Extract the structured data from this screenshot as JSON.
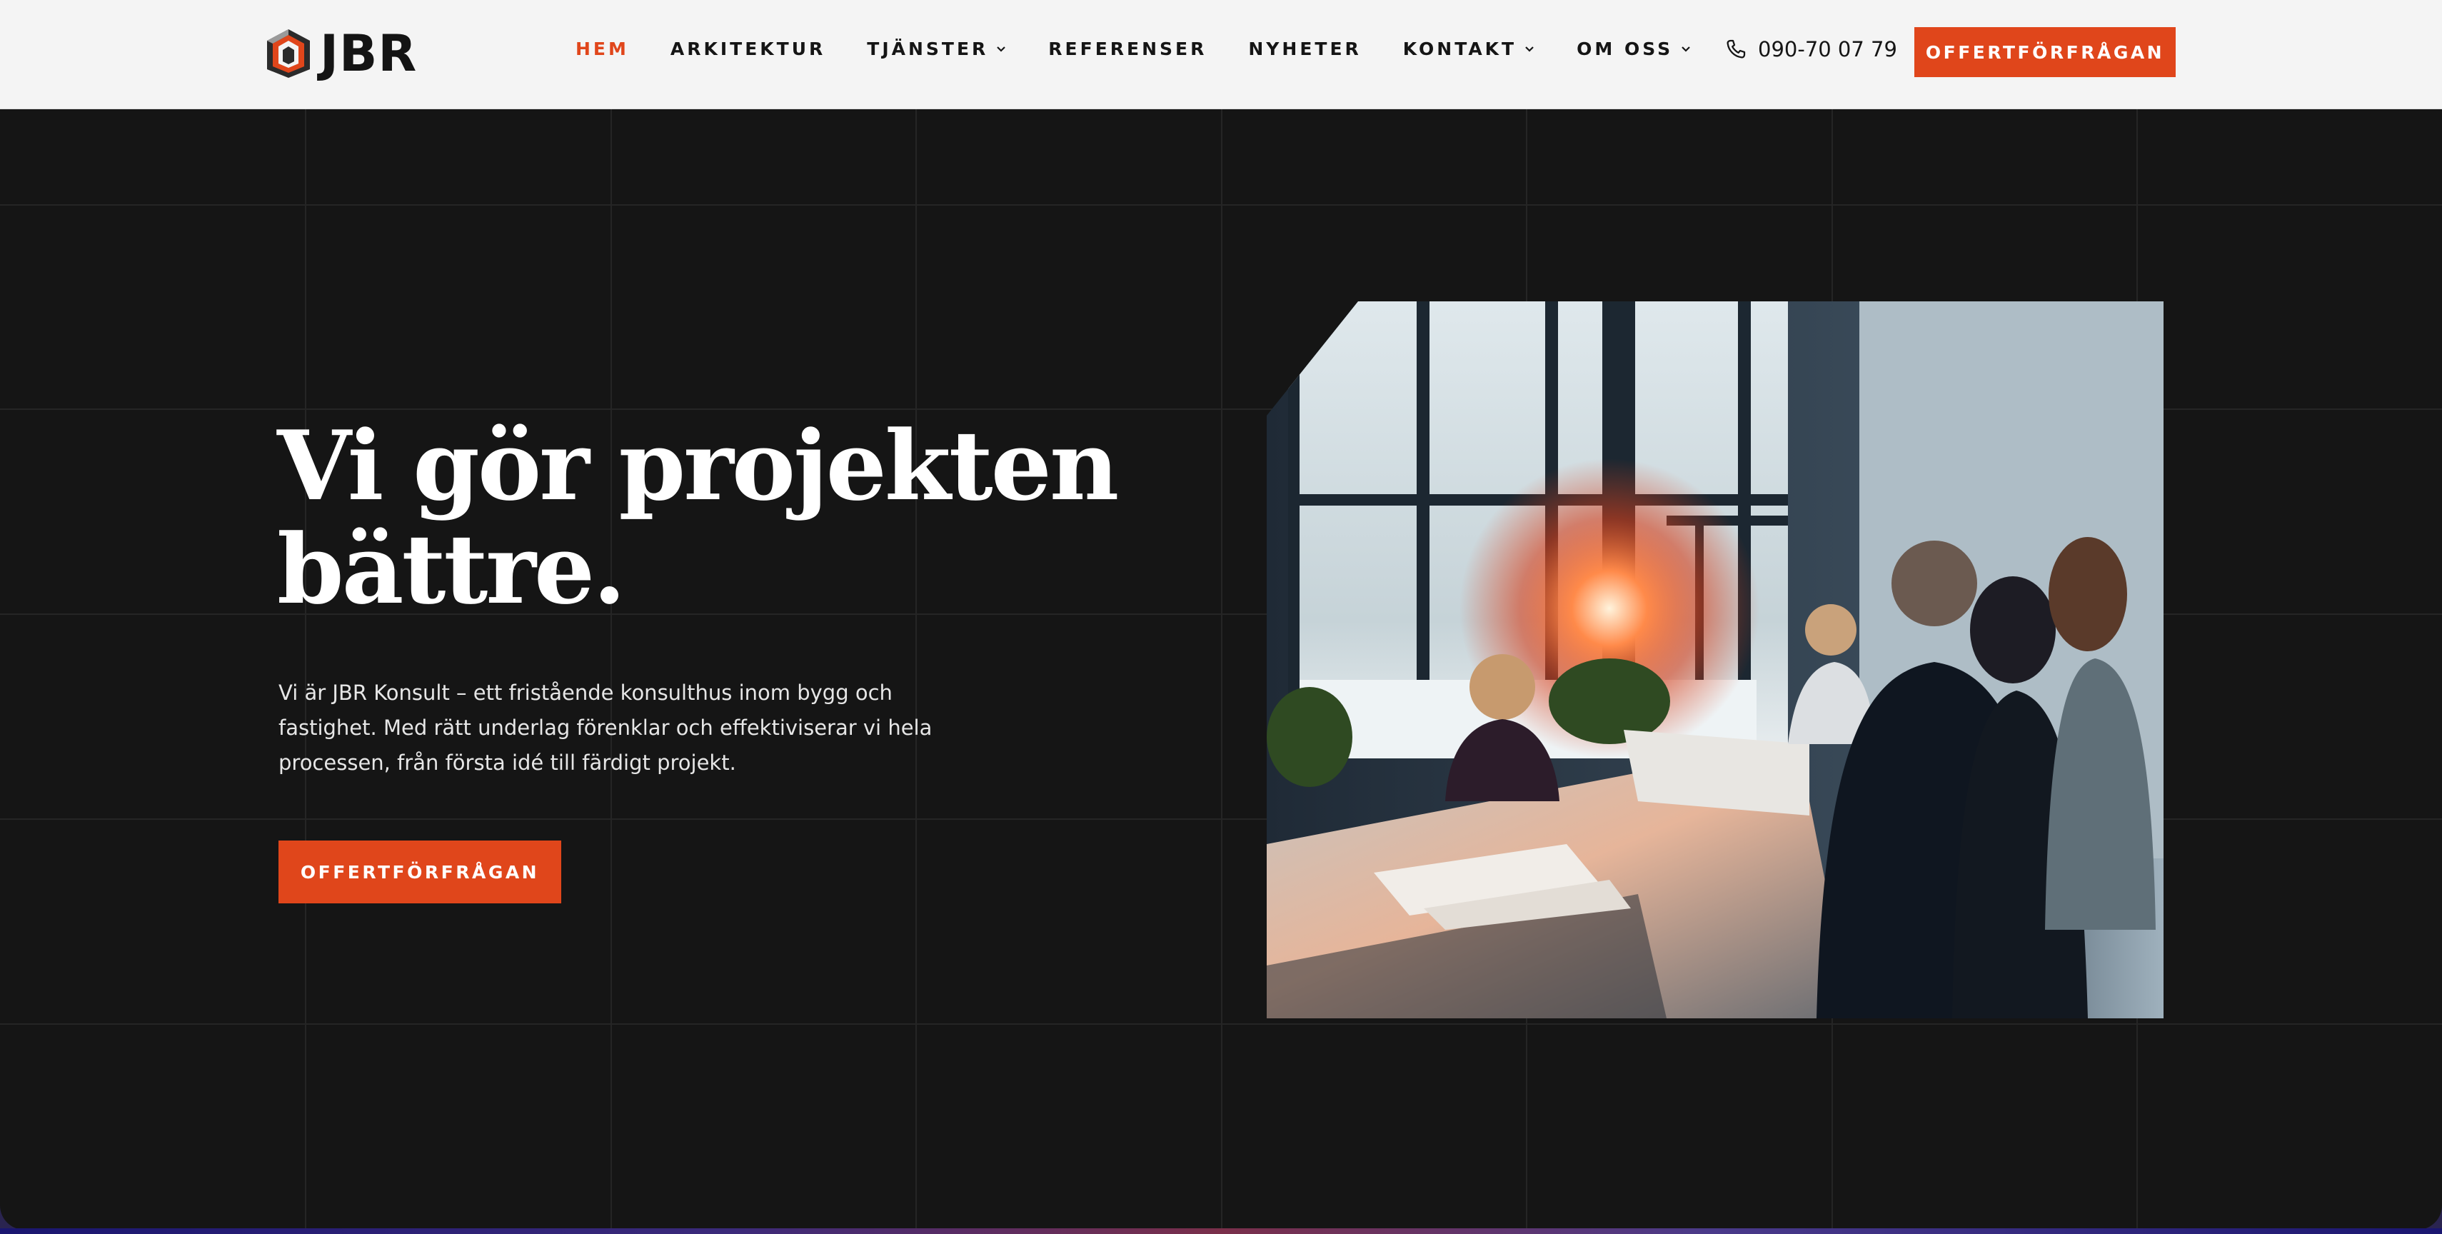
{
  "brand": {
    "name": "JBR",
    "logo_icon": "house-logo-icon"
  },
  "nav": {
    "items": [
      {
        "label": "HEM",
        "active": true,
        "has_dropdown": false
      },
      {
        "label": "ARKITEKTUR",
        "active": false,
        "has_dropdown": false
      },
      {
        "label": "TJÄNSTER",
        "active": false,
        "has_dropdown": true
      },
      {
        "label": "REFERENSER",
        "active": false,
        "has_dropdown": false
      },
      {
        "label": "NYHETER",
        "active": false,
        "has_dropdown": false
      },
      {
        "label": "KONTAKT",
        "active": false,
        "has_dropdown": true
      },
      {
        "label": "OM OSS",
        "active": false,
        "has_dropdown": true
      }
    ]
  },
  "header": {
    "phone": "090-70 07 79",
    "phone_icon": "phone-icon",
    "cta_label": "OFFERTFÖRFRÅGAN"
  },
  "hero": {
    "title_line1": "Vi gör projekten",
    "title_line2": "bättre.",
    "description": "Vi är JBR Konsult – ett fristående konsulthus inom bygg och fastighet. Med rätt underlag förenklar och effektiviserar vi hela processen, från första idé till färdigt projekt.",
    "cta_label": "OFFERTFÖRFRÅGAN",
    "image_subject": "meeting-room-photo"
  },
  "colors": {
    "accent": "#e0461b",
    "background": "#151515",
    "header_bg": "#f4f4f4",
    "text_light": "#ffffff"
  }
}
